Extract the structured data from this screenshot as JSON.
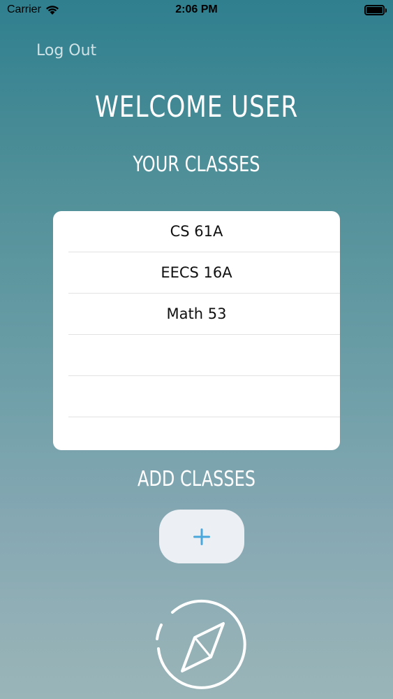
{
  "status_bar": {
    "carrier": "Carrier",
    "time": "2:06 PM"
  },
  "header": {
    "logout_label": "Log Out",
    "welcome_title": "WELCOME USER"
  },
  "classes_section": {
    "title": "YOUR CLASSES",
    "rows": [
      {
        "label": "CS 61A"
      },
      {
        "label": "EECS 16A"
      },
      {
        "label": "Math 53"
      },
      {
        "label": ""
      },
      {
        "label": ""
      },
      {
        "label": ""
      }
    ]
  },
  "add_section": {
    "title": "ADD CLASSES",
    "add_icon": "plus-icon"
  },
  "navigation": {
    "explore_icon": "compass-icon"
  },
  "colors": {
    "plus_blue": "#4ba8dd",
    "button_bg": "#eceff4",
    "gradient_top": "#2f7f8f",
    "gradient_bottom": "#9ab5b8"
  }
}
